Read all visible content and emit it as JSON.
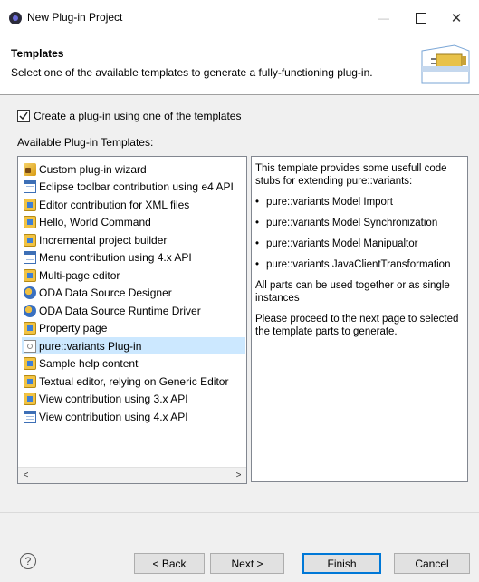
{
  "window": {
    "title": "New Plug-in Project",
    "minimize": "—",
    "close": "✕"
  },
  "banner": {
    "title": "Templates",
    "description": "Select one of the available templates to generate a fully-functioning plug-in."
  },
  "checkbox": {
    "label": "Create a plug-in using one of the templates",
    "checked": true
  },
  "list_label": "Available Plug-in Templates:",
  "templates": [
    {
      "label": "Custom plug-in wizard",
      "icon": "wizard-icon"
    },
    {
      "label": "Eclipse toolbar contribution using e4 API",
      "icon": "window-icon"
    },
    {
      "label": "Editor contribution for XML files",
      "icon": "plugin-icon"
    },
    {
      "label": "Hello, World Command",
      "icon": "plugin-icon"
    },
    {
      "label": "Incremental project builder",
      "icon": "plugin-icon"
    },
    {
      "label": "Menu contribution using 4.x API",
      "icon": "window-icon"
    },
    {
      "label": "Multi-page editor",
      "icon": "plugin-icon"
    },
    {
      "label": "ODA Data Source Designer",
      "icon": "oda-icon"
    },
    {
      "label": "ODA Data Source Runtime Driver",
      "icon": "oda-icon"
    },
    {
      "label": "Property page",
      "icon": "plugin-icon"
    },
    {
      "label": "pure::variants Plug-in",
      "icon": "pure-variants-icon",
      "selected": true
    },
    {
      "label": "Sample help content",
      "icon": "plugin-icon"
    },
    {
      "label": "Textual editor, relying on Generic Editor",
      "icon": "plugin-icon"
    },
    {
      "label": "View contribution using 3.x API",
      "icon": "plugin-icon"
    },
    {
      "label": "View contribution using 4.x API",
      "icon": "window-icon"
    }
  ],
  "scroll": {
    "left": "<",
    "right": ">"
  },
  "description": {
    "intro": "This template provides some usefull code stubs for extending pure::variants:",
    "bullets": [
      "pure::variants Model Import",
      "pure::variants Model Synchronization",
      "pure::variants Model Manipualtor",
      "pure::variants JavaClientTransformation"
    ],
    "para2": "All parts can be used together or as single instances",
    "para3": "Please proceed to the next page to selected the template parts to generate."
  },
  "footer": {
    "help": "?",
    "back": "< Back",
    "next": "Next >",
    "finish": "Finish",
    "cancel": "Cancel"
  },
  "colors": {
    "selection": "#cce8ff",
    "default_button_border": "#0078d7",
    "panel_bg": "#f0f0f0"
  }
}
